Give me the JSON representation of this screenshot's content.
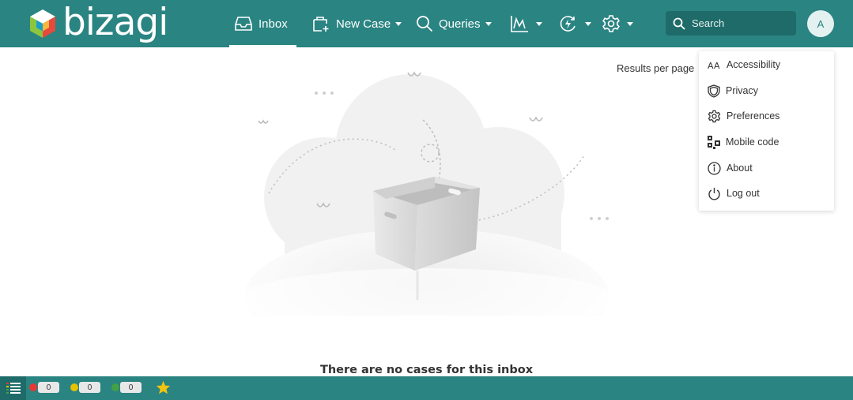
{
  "app": {
    "logo_text": "bizagi"
  },
  "nav": {
    "inbox": "Inbox",
    "new_case": "New Case",
    "queries": "Queries"
  },
  "search": {
    "placeholder": "Search"
  },
  "user": {
    "avatar_initial": "A"
  },
  "results": {
    "label": "Results per page"
  },
  "menu": {
    "items": [
      {
        "label": "Accessibility",
        "icon": "text-size-icon"
      },
      {
        "label": "Privacy",
        "icon": "shield-icon"
      },
      {
        "label": "Preferences",
        "icon": "gear-icon"
      },
      {
        "label": "Mobile code",
        "icon": "qr-code-icon"
      },
      {
        "label": "About",
        "icon": "info-icon"
      },
      {
        "label": "Log out",
        "icon": "power-icon"
      }
    ]
  },
  "empty_state": {
    "message": "There are no cases for this inbox"
  },
  "footer": {
    "counters": [
      {
        "color": "#e53935",
        "count": "0"
      },
      {
        "color": "#e6c200",
        "count": "0"
      },
      {
        "color": "#43a047",
        "count": "0"
      }
    ],
    "favorites_icon": "star-icon"
  },
  "colors": {
    "brand": "#2a8482",
    "brand_dark": "#1e6b69"
  }
}
